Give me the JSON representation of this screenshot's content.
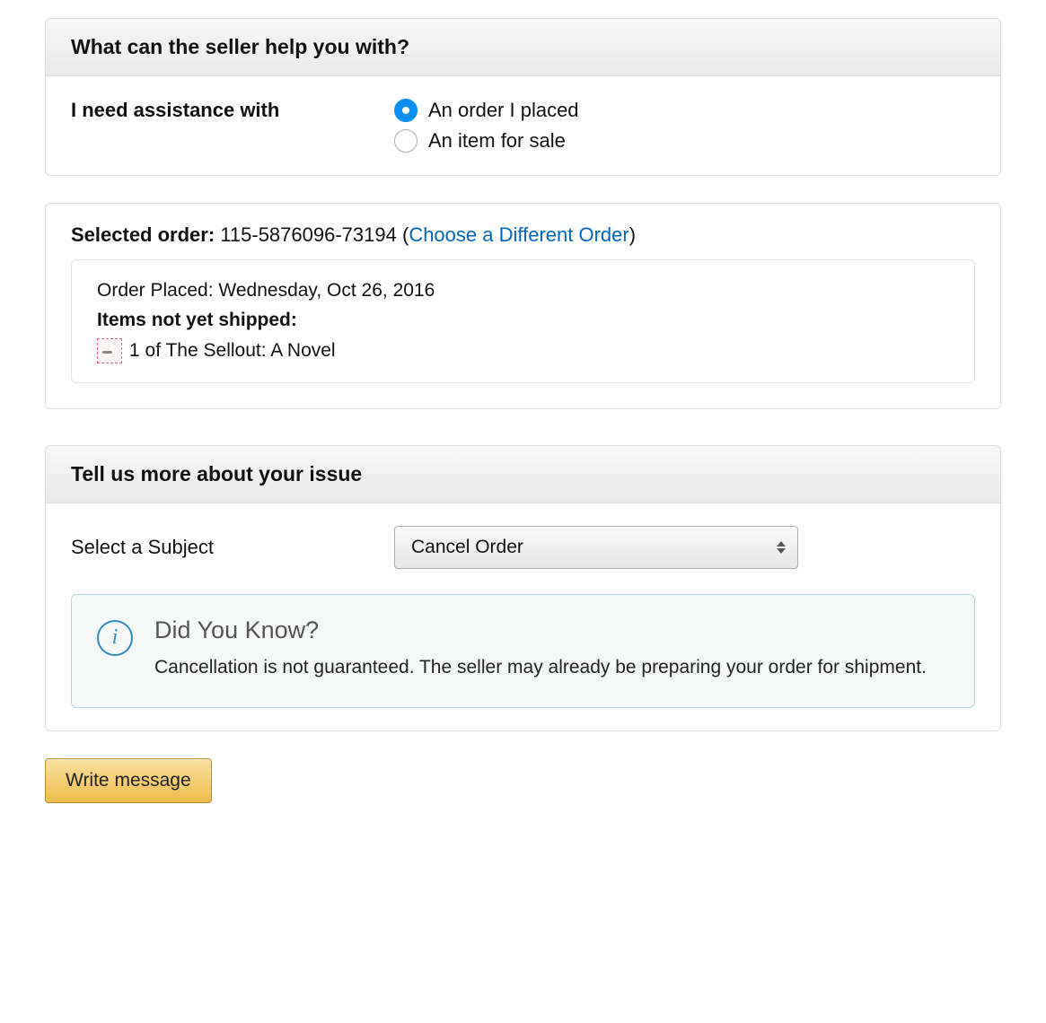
{
  "section1": {
    "header": "What can the seller help you with?",
    "assist_label": "I need assistance with",
    "options": {
      "order_placed": "An order I placed",
      "item_for_sale": "An item for sale"
    },
    "selected": "order_placed"
  },
  "order": {
    "label": "Selected order:",
    "order_id": "115-5876096-73194",
    "change_link": "Choose a Different Order",
    "placed_label": "Order Placed:",
    "placed_date": "Wednesday, Oct 26, 2016",
    "status_label": "Items not yet shipped:",
    "item_text": "1 of The Sellout: A Novel"
  },
  "section2": {
    "header": "Tell us more about your issue",
    "subject_label": "Select a Subject",
    "subject_selected": "Cancel Order",
    "info_title": "Did You Know?",
    "info_text": "Cancellation is not guaranteed. The seller may already be preparing your order for shipment."
  },
  "actions": {
    "write_message": "Write message"
  }
}
